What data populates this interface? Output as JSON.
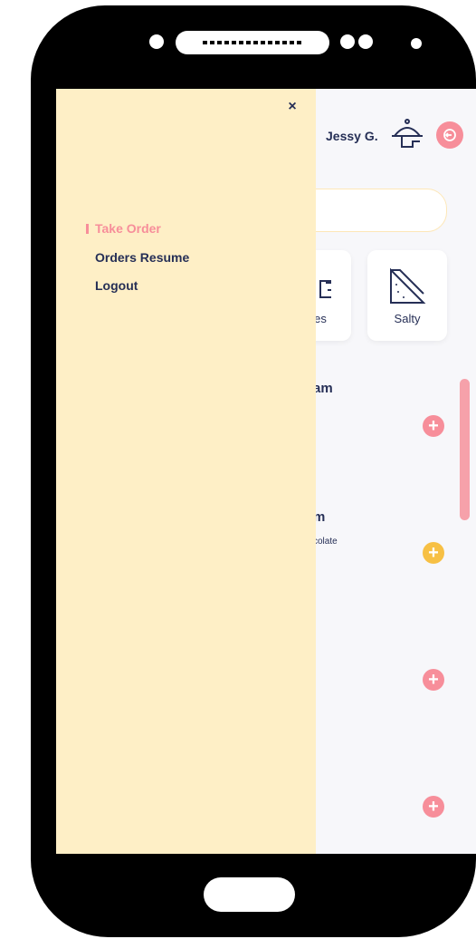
{
  "header": {
    "user_name": "Jessy G."
  },
  "categories": [
    {
      "label": "es",
      "icon": "cake-icon"
    },
    {
      "label": "Salty",
      "icon": "sandwich-icon"
    }
  ],
  "products": [
    {
      "title": "am",
      "description": "",
      "add_color": "#f78e9a"
    },
    {
      "title": "m",
      "description": "colate",
      "add_color": "#f7c044"
    },
    {
      "title": "",
      "description": "",
      "add_color": "#f78e9a"
    },
    {
      "title": "",
      "description": "",
      "add_color": "#f78e9a"
    }
  ],
  "drawer": {
    "close_glyph": "×",
    "items": [
      {
        "label": "Take Order",
        "active": true
      },
      {
        "label": "Orders Resume",
        "active": false
      },
      {
        "label": "Logout",
        "active": false
      }
    ]
  },
  "colors": {
    "accent_pink": "#f78e9a",
    "accent_yellow": "#f7c044",
    "drawer_bg": "#feefc6",
    "text_navy": "#262f56"
  }
}
